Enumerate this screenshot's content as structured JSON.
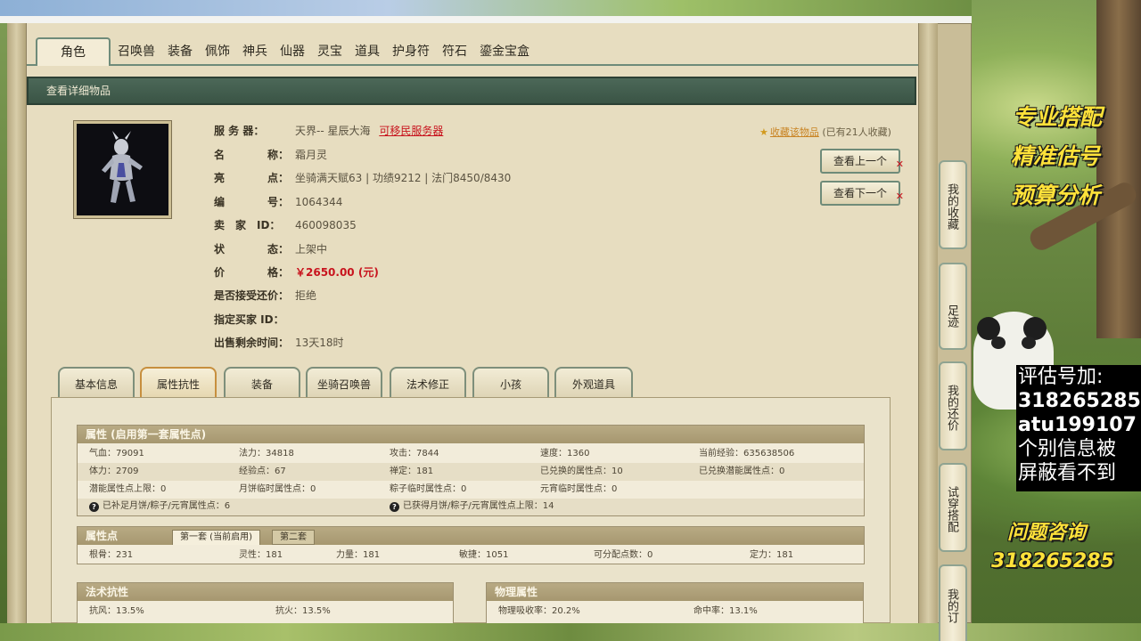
{
  "top_tabs": [
    "角色",
    "召唤兽",
    "装备",
    "佩饰",
    "神兵",
    "仙器",
    "灵宝",
    "道具",
    "护身符",
    "符石",
    "鎏金宝盒"
  ],
  "section_title": "查看详细物品",
  "item": {
    "server_label": "服 务 器：",
    "server_value": "天界-- 星辰大海",
    "server_link": "可移民服务器",
    "name_label": "名　　　　称：",
    "name_value": "霜月灵",
    "highlight_label": "亮　　　　点：",
    "highlight_value": "坐骑满天赋63 | 功绩9212 | 法门8450/8430",
    "id_label": "编　　　　号：",
    "id_value": "1064344",
    "seller_label": "卖　家　ID：",
    "seller_value": "460098035",
    "status_label": "状　　　　态：",
    "status_value": "上架中",
    "price_label": "价　　　　格：",
    "price_value": "￥2650.00 (元)",
    "counter_label": "是否接受还价：",
    "counter_value": "拒绝",
    "buyer_label": "指定买家 ID：",
    "buyer_value": "",
    "remaining_label": "出售剩余时间：",
    "remaining_value": "13天18时"
  },
  "favorite": {
    "link": "收藏该物品",
    "count": "(已有21人收藏)"
  },
  "nav_buttons": {
    "prev": "查看上一个",
    "next": "查看下一个"
  },
  "sub_tabs": [
    "基本信息",
    "属性抗性",
    "装备",
    "坐骑召唤兽",
    "法术修正",
    "小孩",
    "外观道具"
  ],
  "attributes": {
    "title": "属性 (启用第一套属性点)",
    "rows": [
      [
        "气血：79091",
        "法力：34818",
        "攻击：7844",
        "速度：1360",
        "当前经验：635638506"
      ],
      [
        "体力：2709",
        "经验点：67",
        "禅定：181",
        "已兑换的属性点：10",
        "已兑换潜能属性点：0"
      ],
      [
        "潜能属性点上限：0",
        "月饼临时属性点：0",
        "粽子临时属性点：0",
        "元宵临时属性点：0",
        ""
      ]
    ],
    "note_left": "已补足月饼/粽子/元宵属性点：6",
    "note_right": "已获得月饼/粽子/元宵属性点上限：14"
  },
  "points": {
    "title": "属性点",
    "tab_active": "第一套 (当前启用)",
    "tab_inactive": "第二套",
    "values": [
      "根骨：231",
      "灵性：181",
      "力量：181",
      "敏捷：1051",
      "可分配点数：0",
      "定力：181"
    ]
  },
  "magic_resist": {
    "title": "法术抗性",
    "values": [
      "抗风：13.5%",
      "抗火：13.5%"
    ]
  },
  "physical": {
    "title": "物理属性",
    "values": [
      "物理吸收率：20.2%",
      "命中率：13.1%"
    ]
  },
  "side_tabs": [
    "我的收藏",
    "足迹",
    "我的还价",
    "试穿搭配",
    "我的订"
  ],
  "ad": {
    "line1": "专业搭配",
    "line2": "精准估号",
    "line3": "预算分析",
    "box": [
      "评估号加:",
      "318265285",
      "atu199107",
      "个别信息被",
      "屏蔽看不到"
    ],
    "consult": "问题咨询",
    "qq": "318265285"
  }
}
